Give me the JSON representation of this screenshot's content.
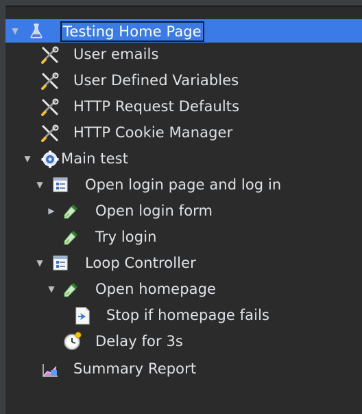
{
  "tree": {
    "root": {
      "label": "Testing Home Page",
      "icon": "beaker-icon"
    },
    "user_emails": {
      "label": "User emails",
      "icon": "wrench-screwdriver-icon"
    },
    "user_defined_variables": {
      "label": "User Defined Variables",
      "icon": "wrench-screwdriver-icon"
    },
    "http_request_defaults": {
      "label": "HTTP Request Defaults",
      "icon": "wrench-screwdriver-icon"
    },
    "http_cookie_manager": {
      "label": "HTTP Cookie Manager",
      "icon": "wrench-screwdriver-icon"
    },
    "main_test": {
      "label": "Main test",
      "icon": "gear-icon"
    },
    "open_login_page": {
      "label": "Open login page and log in",
      "icon": "controller-icon"
    },
    "open_login_form": {
      "label": "Open login form",
      "icon": "pipette-icon"
    },
    "try_login": {
      "label": "Try login",
      "icon": "pipette-icon"
    },
    "loop_controller": {
      "label": "Loop Controller",
      "icon": "controller-icon"
    },
    "open_homepage": {
      "label": "Open homepage",
      "icon": "pipette-icon"
    },
    "stop_if_fails": {
      "label": "Stop if homepage fails",
      "icon": "assertion-icon"
    },
    "delay": {
      "label": "Delay for 3s",
      "icon": "timer-icon"
    },
    "summary_report": {
      "label": "Summary Report",
      "icon": "chart-icon"
    }
  },
  "colors": {
    "selection": "#3b7be8",
    "text": "#dfe3e7",
    "background": "#2b2b2b"
  }
}
